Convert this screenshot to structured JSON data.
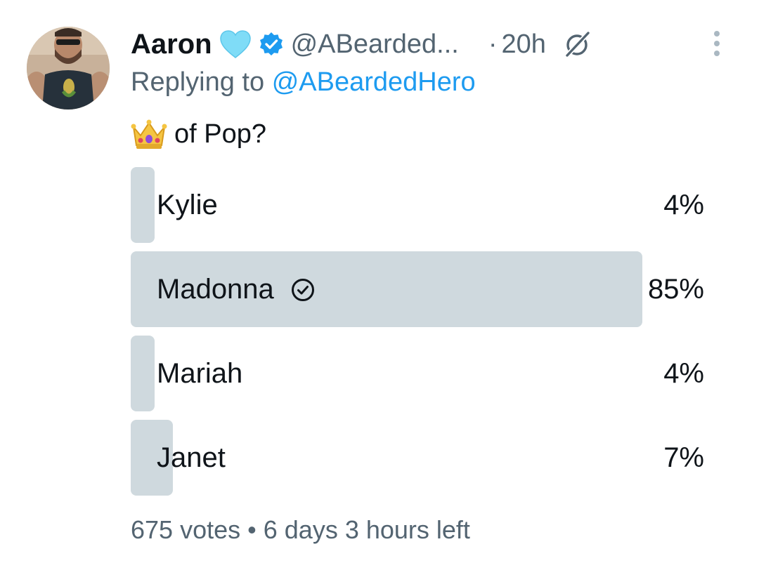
{
  "tweet": {
    "author_name": "Aaron",
    "author_handle": "@ABearded...",
    "separator": "·",
    "time": "20h",
    "reply_prefix": "Replying to",
    "reply_mention": "@ABeardedHero",
    "text": "of Pop?",
    "emoji_icon": "crown-icon"
  },
  "poll": {
    "options": [
      {
        "label": "Kylie",
        "percent_text": "4%",
        "percent": 4,
        "selected": false
      },
      {
        "label": "Madonna",
        "percent_text": "85%",
        "percent": 85,
        "selected": true
      },
      {
        "label": "Mariah",
        "percent_text": "4%",
        "percent": 4,
        "selected": false
      },
      {
        "label": "Janet",
        "percent_text": "7%",
        "percent": 7,
        "selected": false
      }
    ],
    "votes": "675 votes",
    "bullet": "•",
    "time_left": "6 days 3 hours left"
  },
  "colors": {
    "text_primary": "#0f1419",
    "text_secondary": "#536471",
    "link": "#1d9bf0",
    "bar": "#cfd9de",
    "heart": "#7fdcf7",
    "verified": "#1d9bf0"
  }
}
